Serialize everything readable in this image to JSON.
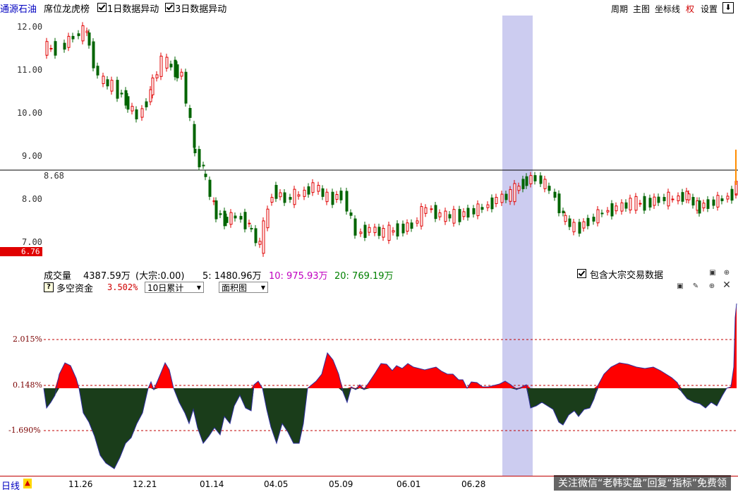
{
  "header": {
    "stock_name": "通源石油",
    "seat_label": "席位龙虎榜",
    "check1_label": "1日数据异动",
    "check2_label": "3日数据异动",
    "menu": {
      "period": "周期",
      "main": "主图",
      "axis": "坐标线",
      "rights": "权",
      "settings": "设置"
    }
  },
  "price_chart": {
    "y_ticks": [
      "12.00",
      "11.00",
      "10.00",
      "9.00",
      "8.00",
      "7.00"
    ],
    "ref_line_value": "8.68",
    "current_price_badge": "6.76"
  },
  "volume_bar": {
    "title": "成交量",
    "value": "4387.59万",
    "bulk_label": "(大宗:0.00)",
    "ma5": "5: 1480.96万",
    "ma10": "10: 975.93万",
    "ma20": "20: 769.19万",
    "bulk_checkbox_label": "包含大宗交易数据"
  },
  "indicator": {
    "help_icon": "?",
    "title": "多空资金",
    "value": "3.502%",
    "period_select": "10日累计",
    "chart_type_select": "面积图",
    "levels": [
      "2.015%",
      "0.148%",
      "-1.690%"
    ]
  },
  "x_axis": {
    "period": "日线",
    "dates": [
      "11.26",
      "12.21",
      "01.14",
      "04.05",
      "05.09",
      "06.01",
      "06.28"
    ]
  },
  "watermark": "关注微信“老韩实盘”回复“指标”免费领",
  "colors": {
    "up": "#e00000",
    "down": "#006400",
    "pos_area": "#ff0000",
    "neg_area": "#1a3d1a",
    "highlight": "#ccccf0"
  },
  "chart_data": {
    "type": "area",
    "title": "多空资金",
    "levels": [
      2.015,
      0.148,
      -1.69
    ],
    "current_value": 3.502,
    "unit": "%"
  }
}
